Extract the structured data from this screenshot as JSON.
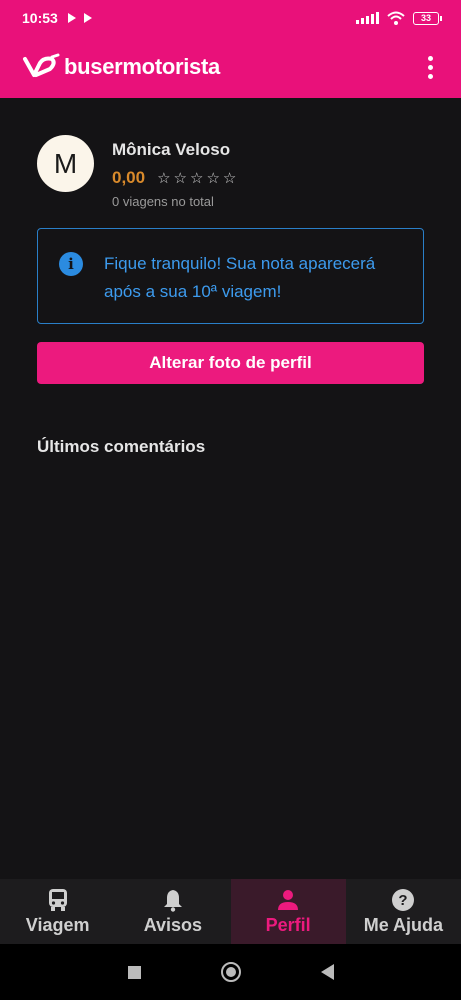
{
  "status_bar": {
    "time": "10:53",
    "battery": "33"
  },
  "app_bar": {
    "brand_bold": "buser",
    "brand_rest": "motorista"
  },
  "profile": {
    "avatar_initial": "M",
    "name": "Mônica Veloso",
    "rating": "0,00",
    "stars_filled": 0,
    "stars_total": 5,
    "trips": "0 viagens no total"
  },
  "info": {
    "line1": "Fique tranquilo! Sua nota aparecerá",
    "line2": "após a sua 10ª viagem!"
  },
  "actions": {
    "change_photo": "Alterar foto de perfil"
  },
  "sections": {
    "latest_comments": "Últimos comentários"
  },
  "bottom_nav": {
    "items": [
      {
        "label": "Viagem",
        "icon": "bus-icon",
        "active": false
      },
      {
        "label": "Avisos",
        "icon": "bell-icon",
        "active": false
      },
      {
        "label": "Perfil",
        "icon": "person-icon",
        "active": true
      },
      {
        "label": "Me Ajuda",
        "icon": "help-icon",
        "active": false
      }
    ]
  },
  "colors": {
    "brand": "#e9117a",
    "background": "#141315",
    "info": "#3d9bee",
    "rating": "#d98a2b"
  }
}
